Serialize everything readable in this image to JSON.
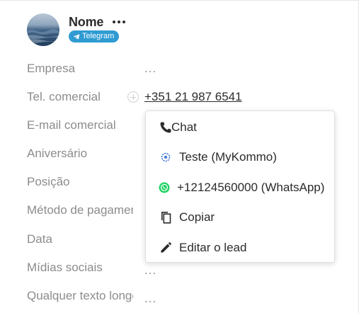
{
  "header": {
    "name": "Nome",
    "badge_label": "Telegram",
    "badge_color": "#2f9bd2"
  },
  "fields": [
    {
      "label": "Empresa",
      "value": "..."
    },
    {
      "label": "Tel. comercial",
      "value": "+351 21 987 6541"
    },
    {
      "label": "E-mail comercial",
      "value": ""
    },
    {
      "label": "Aniversário",
      "value": ""
    },
    {
      "label": "Posição",
      "value": ""
    },
    {
      "label": "Método de pagamento",
      "value": ""
    },
    {
      "label": "Data",
      "value": ""
    },
    {
      "label": "Mídias sociais",
      "value": "..."
    },
    {
      "label": "Qualquer texto longo",
      "value": "..."
    }
  ],
  "menu": {
    "items": [
      {
        "label": "Chat",
        "icon": "phone-icon"
      },
      {
        "label": "Teste (MyKommo)",
        "icon": "mykommo-icon"
      },
      {
        "label": "+12124560000 (WhatsApp)",
        "icon": "whatsapp-icon"
      },
      {
        "label": "Copiar",
        "icon": "copy-icon"
      },
      {
        "label": "Editar o lead",
        "icon": "pencil-icon"
      }
    ]
  },
  "colors": {
    "label": "#8c8c8c",
    "text": "#2b2b2b",
    "accent": "#2f9bd2",
    "whatsapp": "#25d366"
  }
}
